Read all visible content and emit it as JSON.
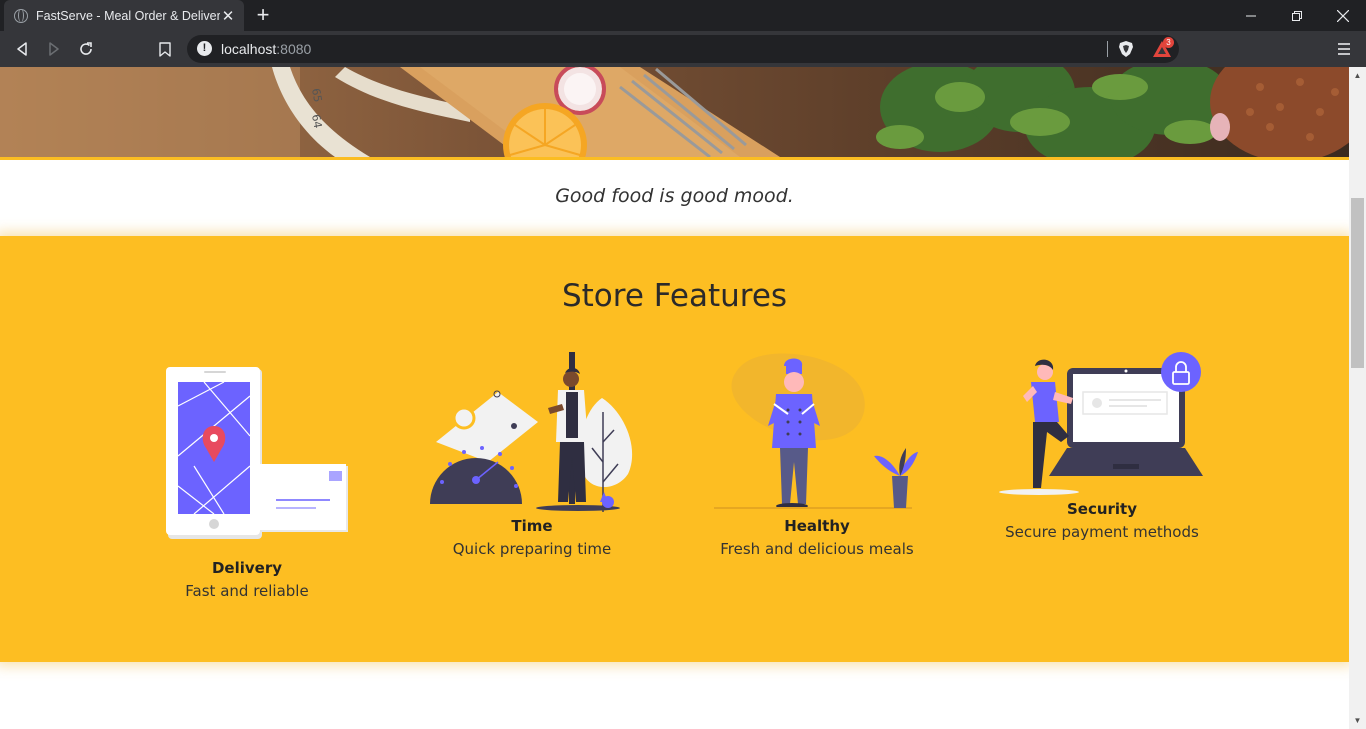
{
  "browser": {
    "tab_title": "FastServe - Meal Order & Delivery",
    "tab_close": "✕",
    "new_tab": "+",
    "url_host": "localhost",
    "url_port": ":8080",
    "rewards_count": "3"
  },
  "page": {
    "tagline": "Good food is good mood.",
    "features_title": "Store Features",
    "features": [
      {
        "name": "Delivery",
        "description": "Fast and reliable",
        "icon": "delivery-map-illustration"
      },
      {
        "name": "Time",
        "description": "Quick preparing time",
        "icon": "time-stopwatch-illustration"
      },
      {
        "name": "Healthy",
        "description": "Fresh and delicious meals",
        "icon": "chef-illustration"
      },
      {
        "name": "Security",
        "description": "Secure payment methods",
        "icon": "laptop-lock-illustration"
      }
    ]
  },
  "colors": {
    "accent_yellow": "#fdbe22",
    "illustration_purple": "#6c63ff",
    "dark_navy": "#3f3d56",
    "chrome_dark": "#202124",
    "chrome_tab": "#35363a"
  }
}
